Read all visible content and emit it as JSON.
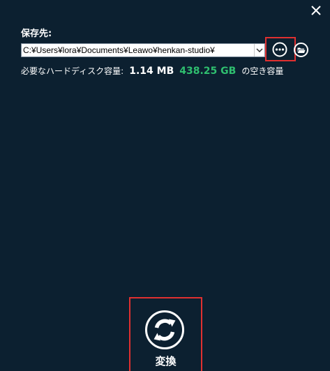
{
  "window": {
    "close_icon": "close-icon"
  },
  "save_destination": {
    "label": "保存先:",
    "path_value": "C:¥Users¥lora¥Documents¥Leawo¥henkan-studio¥",
    "browse_icon": "more-options-icon",
    "open_folder_icon": "open-folder-icon"
  },
  "disk_info": {
    "required_label": "必要なハードディスク容量:",
    "required_size": "1.14 MB",
    "free_size": "438.25 GB",
    "free_label": "の空き容量",
    "free_color": "#2fbf6f"
  },
  "convert": {
    "label": "変換",
    "icon": "refresh-icon"
  },
  "colors": {
    "background": "#0c2030",
    "highlight": "#e03030"
  }
}
